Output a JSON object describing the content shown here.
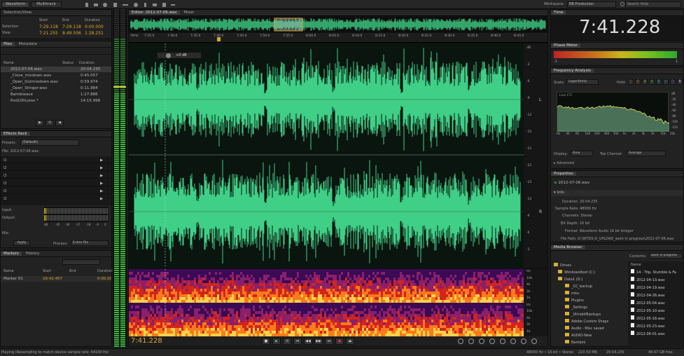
{
  "topbar": {
    "tab_waveform": "Waveform",
    "tab_multitrack": "Multitrack",
    "workspace_label": "Workspace:",
    "workspace_value": "BB-Production",
    "search_placeholder": "Search Help"
  },
  "selection_view": {
    "title": "Selection/View",
    "col_start": "Start",
    "col_end": "End",
    "col_duration": "Duration",
    "sel_label": "Selection",
    "sel_start": "7:29.118",
    "sel_end": "7:29.118",
    "sel_duration": "0:00.000",
    "view_label": "View",
    "view_start": "7:21.255",
    "view_end": "8:49.506",
    "view_duration": "1:28.251"
  },
  "files": {
    "tab": "Files",
    "tab2": "Metadata",
    "col_name": "Name",
    "col_status": "Status",
    "col_duration": "Duration",
    "items": [
      {
        "name": "2012-07-06.wav",
        "duration": "20:04.235"
      },
      {
        "name": "_Close_mixdown.wav",
        "duration": "0:45.057"
      },
      {
        "name": "_Open_Outmixdown.wav",
        "duration": "0:59.974"
      },
      {
        "name": "_Open_Stinger.wav",
        "duration": "0:11.884"
      },
      {
        "name": "Bambiwave",
        "duration": "1:27.886"
      },
      {
        "name": "Pod100Lores *",
        "duration": "14:15.998"
      }
    ]
  },
  "effects": {
    "title": "Effects Rack",
    "preset_label": "Presets:",
    "preset_value": "(Default)",
    "file_label": "File: 2012-07-06.wav",
    "input_label": "Input:",
    "output_label": "Output:",
    "mix_label": "Mix:",
    "apply_label": "Apply",
    "process_label": "Process:",
    "process_value": "Entire File",
    "meter_ticks": [
      "dB",
      "-45",
      "-36",
      "-27",
      "-18",
      "-9",
      "0"
    ]
  },
  "markers": {
    "tab": "Markers",
    "tab2": "History",
    "col_name": "Name",
    "col_start": "Start",
    "col_end": "End",
    "col_duration": "Duration",
    "marker_name": "Marker 01",
    "marker_start": "16:42.457",
    "marker_duration": "0:00.000"
  },
  "editor": {
    "tab": "Editor: 2012-07-06.wav",
    "tab2": "Mixer",
    "ruler_unit": "hms",
    "ruler": [
      "7:25.0",
      "7:30.0",
      "7:35.0",
      "7:40.0",
      "7:45.0",
      "7:50.0",
      "7:55.0",
      "8:00.0",
      "8:05.0",
      "8:10.0",
      "8:15.0",
      "8:20.0",
      "8:25.0",
      "8:30.0",
      "8:35.0",
      "8:40.0",
      "8:45.0"
    ],
    "hud_gain": "+0 dB",
    "db_scale": [
      "dB",
      "-3",
      "-6",
      "-9",
      "-12",
      "-15",
      "-21",
      "-21",
      "-15",
      "-12",
      "-9",
      "-6",
      "-3"
    ],
    "hz_scale": [
      "Hz",
      "10k",
      "4k",
      "2k",
      "1k",
      "Hz",
      "10k",
      "4k",
      "2k",
      "1k"
    ],
    "channel_l": "L",
    "channel_r": "R",
    "time_display": "7:41.228"
  },
  "time_panel": {
    "title": "Time",
    "value": "7:41.228"
  },
  "phase_meter": {
    "title": "Phase Meter",
    "left": "-1",
    "right": "1"
  },
  "freq": {
    "title": "Frequency Analysis",
    "scale_label": "Scale:",
    "scale_value": "Logarithmic",
    "hold_label": "Hold:",
    "hold_buttons": [
      "1",
      "2",
      "3",
      "4",
      "5",
      "6",
      "7",
      "8"
    ],
    "live": "Live CTI",
    "db_ticks": [
      "dB",
      "-20",
      "-40",
      "-60",
      "-80",
      "-100",
      "-120"
    ],
    "hz_ticks": [
      "Hz",
      "40",
      "60",
      "100",
      "200",
      "300",
      "500",
      "1k",
      "2k",
      "3k",
      "5k",
      "10k",
      "20k"
    ],
    "display_label": "Display:",
    "display_value": "Area",
    "top_channel_label": "Top Channel:",
    "top_channel_value": "Average",
    "advanced": "Advanced"
  },
  "properties": {
    "title": "Properties",
    "filename": "2012-07-06.wav",
    "info": "Info",
    "duration": "Duration: 20:04.235",
    "sample_rate": "Sample Rate: 48000 Hz",
    "channels": "Channels: Stereo",
    "bit_depth": "Bit Depth: 16 bit",
    "format": "Format: Waveform Audio 16 bit Integer",
    "file_path": "File Path: D:\\WTDS-O_UPLOAD_work in progress\\2012-07-06.wav"
  },
  "media": {
    "title": "Media Browser",
    "contents_label": "Contents:",
    "contents_value": "work in progress",
    "name_col": "Name",
    "tree": [
      "Drives",
      "Windows8oot (C:)",
      "Data1 (D:)",
      "_CC_backup",
      "misc",
      "Plugins",
      "_Settings",
      "_UltrabitBackups",
      "Adobe Custom Shaps",
      "Audio - Misc saved",
      "AUDIO-New",
      "Bambini"
    ],
    "files": [
      "14 - Trip, Stumble & Fa",
      "2012-04-13.wav",
      "2012-04-19.wav",
      "2012-04-26.wav",
      "2012-05-04.wav",
      "2012-05-10.wav",
      "2012-05-18.wav",
      "2012-05-23.wav",
      "2012-06-01.wav"
    ]
  },
  "status": {
    "left": "Playing (Resampling to match device sample rate: 44100 Hz)",
    "format": "48000 Hz • 16-bit • Stereo",
    "size": "220.50 MB",
    "duration": "20:04.235",
    "free": "46.67 GB free"
  },
  "colors": {
    "accent": "#e1a82d",
    "waveform": "#3fcf86",
    "panel": "#222222"
  }
}
